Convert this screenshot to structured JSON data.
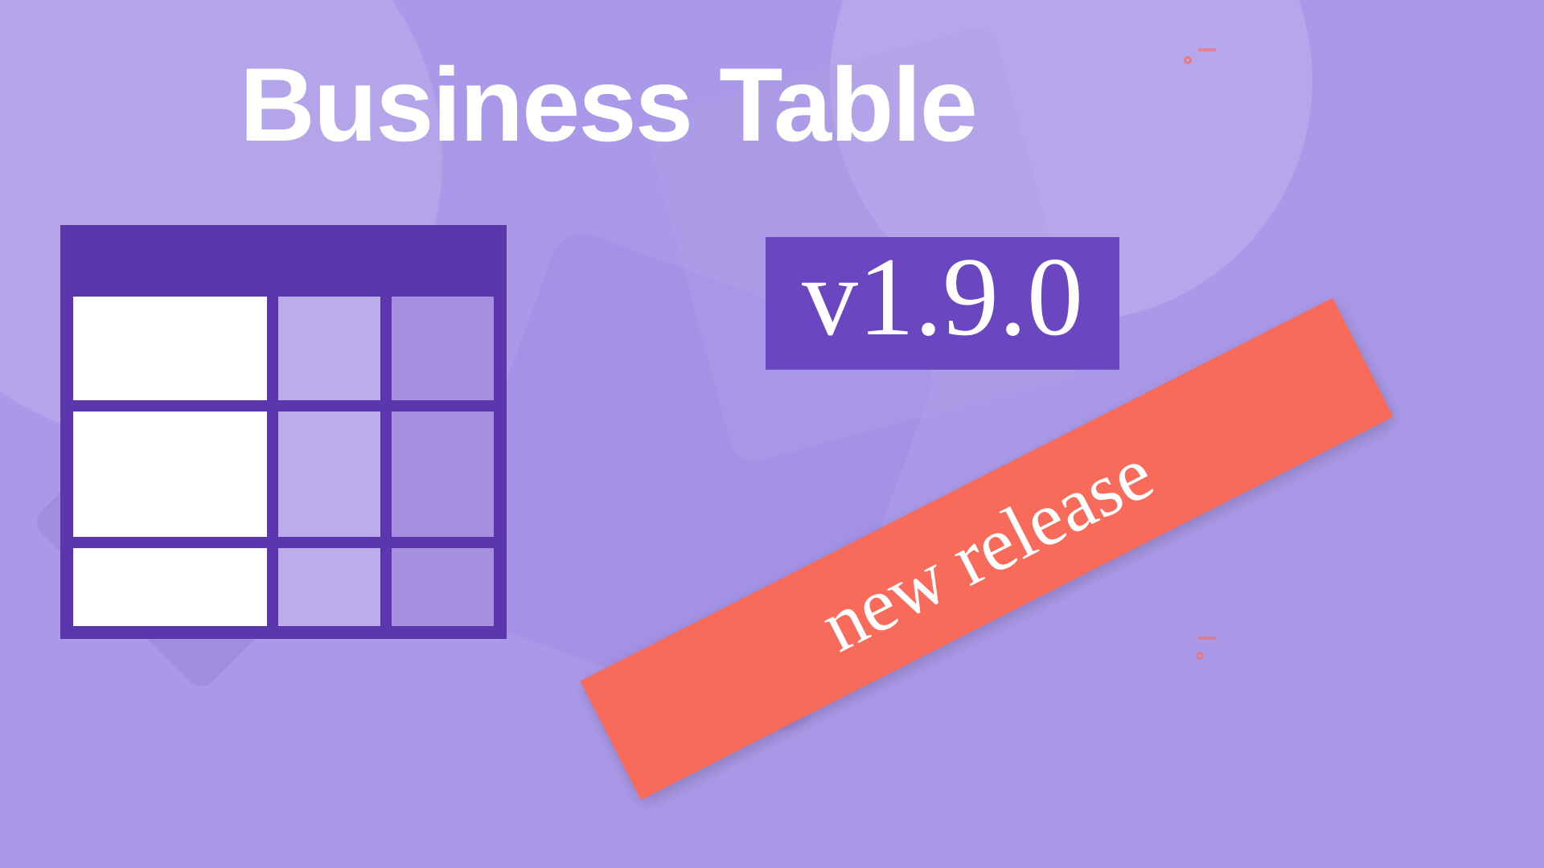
{
  "title": "Business Table",
  "version": "v1.9.0",
  "ribbon": "new release"
}
